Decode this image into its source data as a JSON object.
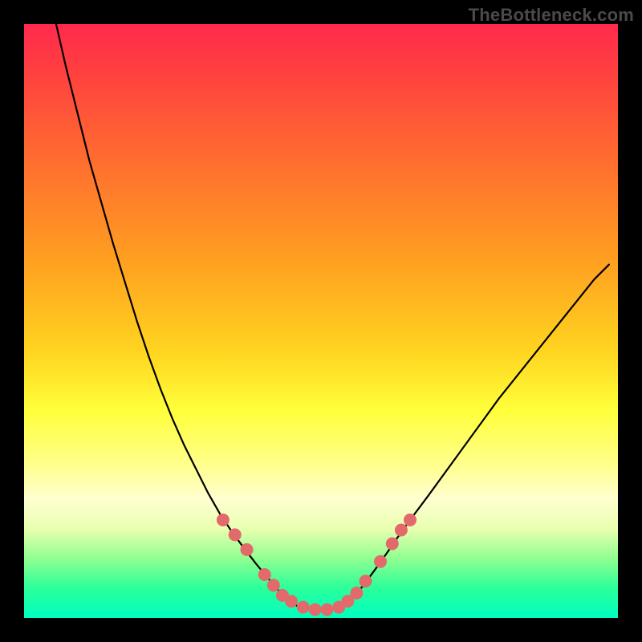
{
  "watermark": {
    "text": "TheBottleneck.com"
  },
  "chart_data": {
    "type": "line",
    "title": "",
    "xlabel": "",
    "ylabel": "",
    "xlim": [
      0,
      100
    ],
    "ylim": [
      0,
      100
    ],
    "grid": false,
    "legend": false,
    "series": [
      {
        "name": "curve",
        "color": "#000000",
        "x": [
          5.4,
          7,
          9,
          11,
          13,
          15,
          17,
          19,
          21,
          23,
          25,
          27,
          29,
          31,
          33,
          35,
          37,
          39,
          41,
          42.5,
          44,
          46,
          48.5,
          51,
          53.5,
          55,
          57,
          59,
          61,
          63,
          65,
          68,
          72,
          76,
          80,
          84,
          88,
          92,
          96,
          98.5
        ],
        "y": [
          100,
          93,
          85,
          77,
          70,
          63,
          56.5,
          50,
          44,
          38.5,
          33.5,
          29,
          25,
          21,
          17.5,
          14.5,
          11.8,
          9.2,
          6.8,
          5,
          3.4,
          2,
          1.3,
          1.3,
          2,
          3.2,
          5.3,
          8,
          10.8,
          13.7,
          16.5,
          20.5,
          26,
          31.5,
          37,
          42,
          47,
          52,
          57,
          59.5
        ]
      }
    ],
    "markers": [
      {
        "name": "dots",
        "color": "#e36a6a",
        "radius_px": 8,
        "x": [
          33.5,
          35.5,
          37.5,
          40.5,
          42,
          43.5,
          45,
          47,
          49,
          51,
          53,
          54.5,
          56,
          57.5,
          60,
          62,
          63.5,
          65
        ],
        "y": [
          16.5,
          14,
          11.5,
          7.3,
          5.5,
          3.8,
          2.8,
          1.8,
          1.4,
          1.4,
          1.8,
          2.8,
          4.2,
          6.2,
          9.5,
          12.5,
          14.8,
          16.5
        ]
      }
    ],
    "background": {
      "type": "vertical-gradient",
      "stops": [
        {
          "pos": 0.0,
          "color": "#ff2a4d"
        },
        {
          "pos": 0.22,
          "color": "#ff6a30"
        },
        {
          "pos": 0.55,
          "color": "#ffd420"
        },
        {
          "pos": 0.75,
          "color": "#ffff8a"
        },
        {
          "pos": 0.9,
          "color": "#90ff90"
        },
        {
          "pos": 1.0,
          "color": "#00ffc0"
        }
      ]
    }
  }
}
